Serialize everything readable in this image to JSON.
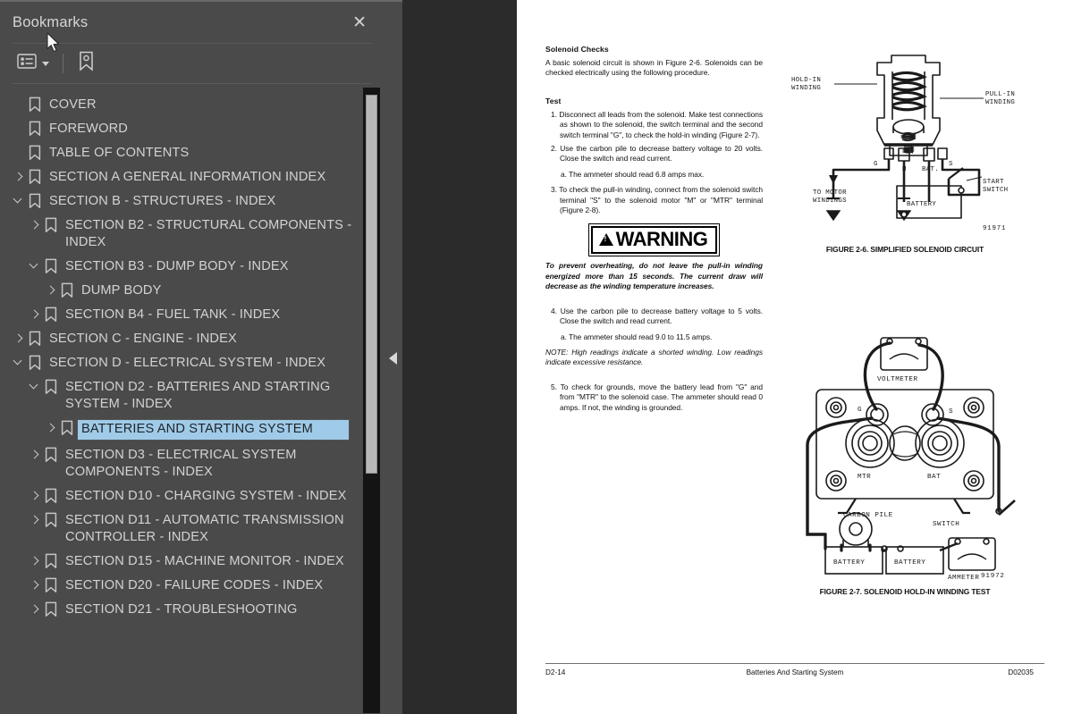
{
  "panel": {
    "title": "Bookmarks",
    "close_label": "✕",
    "toolbar": {
      "options_icon": "list-options-icon",
      "options_caret": "chevron-down-icon",
      "new_bookmark_icon": "new-bookmark-icon"
    }
  },
  "bookmarks": [
    {
      "label": "COVER",
      "indent": 0,
      "state": "leaf",
      "selected": false
    },
    {
      "label": "FOREWORD",
      "indent": 0,
      "state": "leaf",
      "selected": false
    },
    {
      "label": "TABLE OF CONTENTS",
      "indent": 0,
      "state": "leaf",
      "selected": false
    },
    {
      "label": "SECTION A GENERAL INFORMATION INDEX",
      "indent": 0,
      "state": "closed",
      "selected": false
    },
    {
      "label": "SECTION B - STRUCTURES - INDEX",
      "indent": 0,
      "state": "open",
      "selected": false
    },
    {
      "label": "SECTION B2 - STRUCTURAL COMPONENTS - INDEX",
      "indent": 1,
      "state": "closed",
      "selected": false
    },
    {
      "label": "SECTION B3 - DUMP BODY - INDEX",
      "indent": 1,
      "state": "open",
      "selected": false
    },
    {
      "label": "DUMP BODY",
      "indent": 2,
      "state": "closed",
      "selected": false
    },
    {
      "label": "SECTION B4 - FUEL TANK - INDEX",
      "indent": 1,
      "state": "closed",
      "selected": false
    },
    {
      "label": "SECTION C - ENGINE - INDEX",
      "indent": 0,
      "state": "closed",
      "selected": false
    },
    {
      "label": "SECTION D - ELECTRICAL SYSTEM - INDEX",
      "indent": 0,
      "state": "open",
      "selected": false
    },
    {
      "label": "SECTION D2 - BATTERIES AND STARTING SYSTEM - INDEX",
      "indent": 1,
      "state": "open",
      "selected": false
    },
    {
      "label": "BATTERIES AND STARTING SYSTEM",
      "indent": 2,
      "state": "closed",
      "selected": true
    },
    {
      "label": "SECTION D3 - ELECTRICAL SYSTEM COMPONENTS - INDEX",
      "indent": 1,
      "state": "closed",
      "selected": false
    },
    {
      "label": "SECTION D10 - CHARGING SYSTEM - INDEX",
      "indent": 1,
      "state": "closed",
      "selected": false
    },
    {
      "label": "SECTION D11  - AUTOMATIC TRANSMISSION CONTROLLER - INDEX",
      "indent": 1,
      "state": "closed",
      "selected": false
    },
    {
      "label": "SECTION D15 - MACHINE MONITOR - INDEX",
      "indent": 1,
      "state": "closed",
      "selected": false
    },
    {
      "label": "SECTION D20 - FAILURE CODES - INDEX",
      "indent": 1,
      "state": "closed",
      "selected": false
    },
    {
      "label": "SECTION D21 -  TROUBLESHOOTING",
      "indent": 1,
      "state": "closed",
      "selected": false
    }
  ],
  "document": {
    "left_column": {
      "heading": "Solenoid Checks",
      "intro": "A basic solenoid circuit is shown in Figure 2-6. Solenoids can be checked electrically using the following procedure.",
      "test_heading": "Test",
      "steps": [
        "1. Disconnect all leads from the solenoid. Make test connections as shown to the solenoid, the switch terminal and the second switch terminal \"G\", to check the hold-in winding (Figure 2-7).",
        "2. Use the carbon pile to decrease battery voltage to 20 volts. Close the switch and read current.",
        "a. The ammeter should read 6.8 amps max.",
        "3. To check the pull-in winding, connect from the solenoid switch terminal \"S\" to the solenoid motor \"M\" or \"MTR\" terminal (Figure 2-8)."
      ],
      "warning_word": "WARNING",
      "warning_text": "To prevent overheating, do not leave the pull-in winding energized more than 15 seconds. The current draw will decrease as the winding temperature increases.",
      "steps2": [
        "4. Use the carbon pile to decrease battery voltage to 5 volts. Close the switch and read current.",
        "a. The ammeter should read 9.0 to 11.5 amps."
      ],
      "note": "NOTE: High readings indicate a shorted winding. Low readings indicate excessive resistance.",
      "steps3": [
        "5. To check for grounds, move the battery lead from \"G\" and from \"MTR\" to the solenoid case. The ammeter should read 0 amps. If not, the winding is grounded."
      ]
    },
    "figure1": {
      "caption": "FIGURE 2-6. SIMPLIFIED SOLENOID CIRCUIT",
      "drawing_number": "91971",
      "labels": {
        "hold_in_1": "HOLD-IN",
        "hold_in_2": "WINDING",
        "pull_in_1": "PULL-IN",
        "pull_in_2": "WINDING",
        "g": "G",
        "s": "S",
        "m": "M",
        "bat": "BAT.",
        "start_1": "START",
        "start_2": "SWITCH",
        "motor_1": "TO MOTOR",
        "motor_2": "WINDINGS",
        "battery": "BATTERY"
      }
    },
    "figure2": {
      "caption": "FIGURE 2-7. SOLENOID HOLD-IN WINDING TEST",
      "drawing_number": "91972",
      "labels": {
        "voltmeter": "VOLTMETER",
        "g": "G",
        "s": "S",
        "mtr": "MTR",
        "bat": "BAT",
        "carbon_pile": "CARBON PILE",
        "switch": "SWITCH",
        "battery1": "BATTERY",
        "battery2": "BATTERY",
        "ammeter": "AMMETER"
      }
    },
    "footer": {
      "page_number": "D2-14",
      "section_title": "Batteries And Starting System",
      "doc_code": "D02035"
    }
  },
  "colors": {
    "panel_bg": "#4a4a4a",
    "viewer_bg": "#2b2b2b",
    "selection": "#9fcbe8",
    "text": "#d3d3d3"
  }
}
